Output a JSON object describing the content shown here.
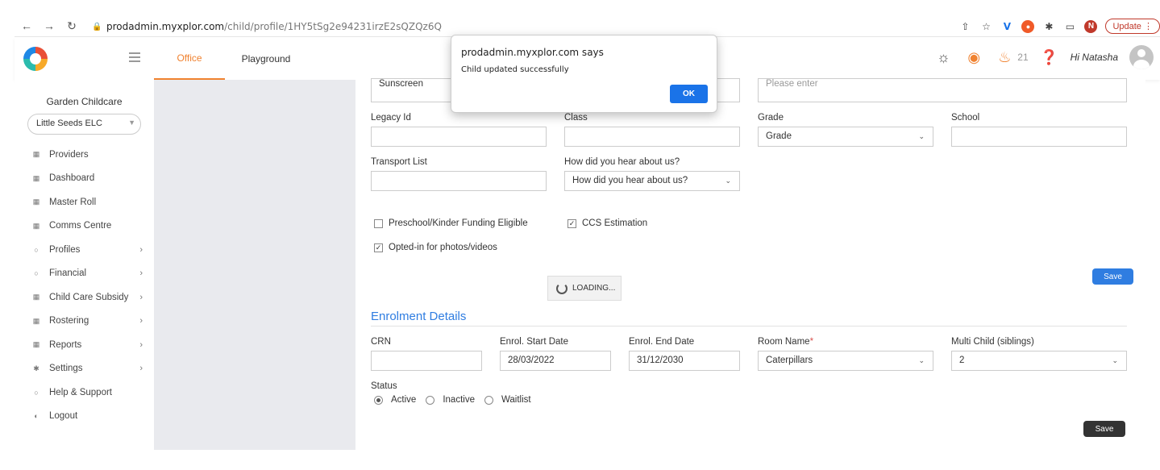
{
  "browser": {
    "url_host": "prodadmin.myxplor.com",
    "url_path": "/child/profile/1HY5tSg2e94231irzE2sQZQz6Q",
    "update_label": "Update",
    "avatar_letter": "N"
  },
  "header": {
    "tabs": [
      {
        "label": "Office",
        "active": true
      },
      {
        "label": "Playground",
        "active": false
      }
    ],
    "notification_count": "21",
    "greeting": "Hi Natasha"
  },
  "sidebar": {
    "org_name": "Garden Childcare",
    "site_selected": "Little Seeds ELC",
    "items": [
      {
        "label": "Providers",
        "icon": "building-icon",
        "chevron": false
      },
      {
        "label": "Dashboard",
        "icon": "grid-icon",
        "chevron": false
      },
      {
        "label": "Master Roll",
        "icon": "calendar-icon",
        "chevron": false
      },
      {
        "label": "Comms Centre",
        "icon": "message-icon",
        "chevron": false
      },
      {
        "label": "Profiles",
        "icon": "profile-icon",
        "chevron": true
      },
      {
        "label": "Financial",
        "icon": "dollar-icon",
        "chevron": true
      },
      {
        "label": "Child Care Subsidy",
        "icon": "bank-icon",
        "chevron": true
      },
      {
        "label": "Rostering",
        "icon": "roster-icon",
        "chevron": true
      },
      {
        "label": "Reports",
        "icon": "report-icon",
        "chevron": true
      },
      {
        "label": "Settings",
        "icon": "gear-icon",
        "chevron": true
      },
      {
        "label": "Help & Support",
        "icon": "help-icon",
        "chevron": false
      },
      {
        "label": "Logout",
        "icon": "logout-icon",
        "chevron": false
      }
    ]
  },
  "form": {
    "sunscreen_value": "Sunscreen",
    "right_textarea_placeholder": "Please enter",
    "legacy_id_label": "Legacy Id",
    "legacy_id_value": "",
    "class_label": "Class",
    "class_value": "",
    "grade_label": "Grade",
    "grade_value": "Grade",
    "school_label": "School",
    "school_value": "",
    "transport_label": "Transport List",
    "transport_value": "",
    "hear_label": "How did you hear about us?",
    "hear_value": "How did you hear about us?",
    "checkboxes": {
      "funding_label": "Preschool/Kinder Funding Eligible",
      "funding_checked": false,
      "ccs_label": "CCS Estimation",
      "ccs_checked": true,
      "photos_label": "Opted-in for photos/videos",
      "photos_checked": true
    },
    "save_label": "Save",
    "loading_label": "LOADING..."
  },
  "enrolment": {
    "title": "Enrolment Details",
    "crn_label": "CRN",
    "crn_value": "",
    "start_label": "Enrol. Start Date",
    "start_value": "28/03/2022",
    "end_label": "Enrol. End Date",
    "end_value": "31/12/2030",
    "room_label": "Room Name",
    "room_required": "*",
    "room_value": "Caterpillars",
    "multi_label": "Multi Child (siblings)",
    "multi_value": "2",
    "status_label": "Status",
    "status_options": [
      "Active",
      "Inactive",
      "Waitlist"
    ],
    "status_selected": "Active",
    "save_label": "Save"
  },
  "dialog": {
    "title": "prodadmin.myxplor.com says",
    "message": "Child updated successfully",
    "ok_label": "OK"
  },
  "colors": {
    "accent_orange": "#f08230",
    "primary_blue": "#2f7de1",
    "dialog_blue": "#1a73e8"
  }
}
